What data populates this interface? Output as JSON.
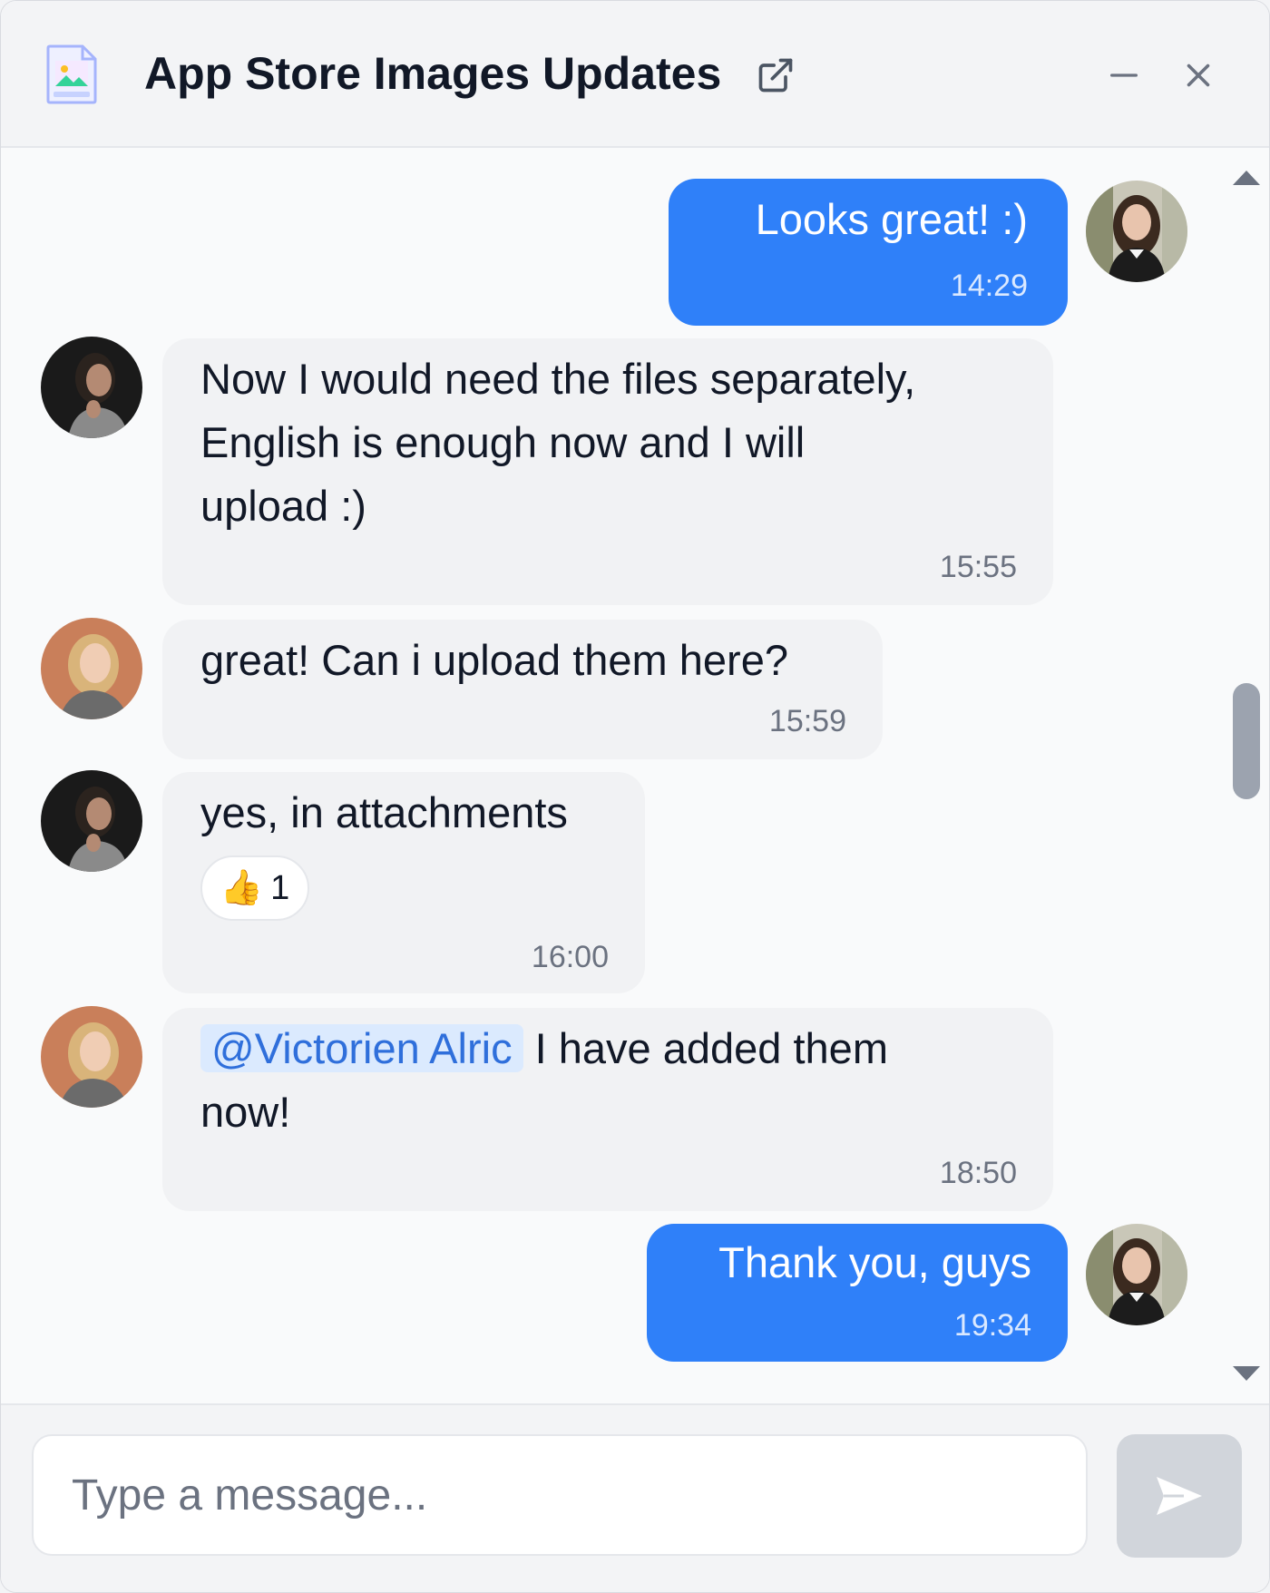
{
  "header": {
    "title": "App Store Images Updates",
    "icons": [
      "image-file-icon",
      "external-link-icon",
      "minimize-icon",
      "close-icon"
    ]
  },
  "messages": [
    {
      "sender": "me",
      "text_lines": [
        "Looks great! :)"
      ],
      "time": "14:29"
    },
    {
      "sender": "them",
      "text_lines": [
        "Now I would need the files separately,",
        "English is enough now and I will",
        "upload :)"
      ],
      "time": "15:55"
    },
    {
      "sender": "them",
      "text_lines": [
        "great! Can i upload them here?"
      ],
      "time": "15:59"
    },
    {
      "sender": "them",
      "text_lines": [
        "yes, in attachments"
      ],
      "reaction": {
        "emoji": "👍",
        "count": "1"
      },
      "time": "16:00"
    },
    {
      "sender": "them",
      "mention": "@Victorien Alric",
      "text_lines": [
        " I have added them",
        "now!"
      ],
      "time": "18:50"
    },
    {
      "sender": "me",
      "text_lines": [
        "Thank you, guys"
      ],
      "time": "19:34"
    }
  ],
  "composer": {
    "placeholder": "Type a message..."
  },
  "colors": {
    "accent": "#2f80f9",
    "bubble_other": "#f1f2f4",
    "mention_bg": "#dbeafe",
    "send_disabled": "#d1d5db"
  }
}
